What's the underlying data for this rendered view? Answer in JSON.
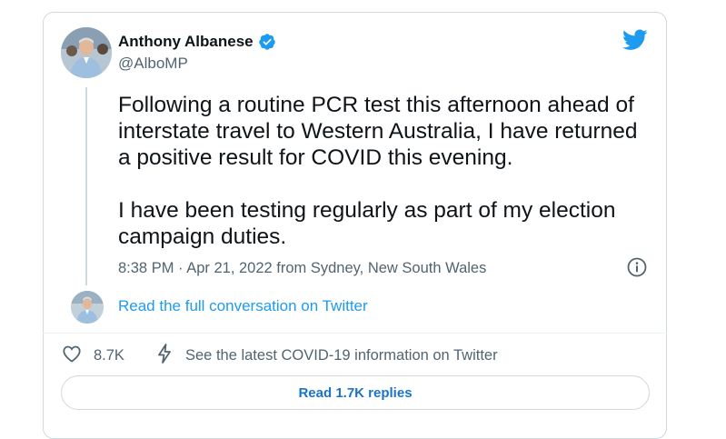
{
  "author": {
    "name": "Anthony Albanese",
    "handle": "@AlboMP",
    "verified": true
  },
  "tweet": {
    "paragraphs": [
      "Following a routine PCR test this afternoon ahead of interstate travel to Western Australia, I have returned a positive result for COVID this evening.",
      "I have been testing regularly as part of my election campaign duties."
    ],
    "meta": "8:38 PM · Apr 21, 2022 from Sydney, New South Wales"
  },
  "conversation": {
    "link_label": "Read the full conversation on Twitter"
  },
  "actions": {
    "like_count": "8.7K",
    "covid_info_label": "See the latest COVID-19 information on Twitter"
  },
  "replies_button": {
    "label": "Read 1.7K replies"
  },
  "icons": {
    "brand": "twitter-bird-icon",
    "verified": "verified-badge-icon",
    "info": "info-icon",
    "like": "heart-icon",
    "covid": "lightning-icon"
  },
  "colors": {
    "brand_blue": "#1d9bf0",
    "text_primary": "#0f1419",
    "text_secondary": "#536471",
    "border": "#cfd9de"
  }
}
